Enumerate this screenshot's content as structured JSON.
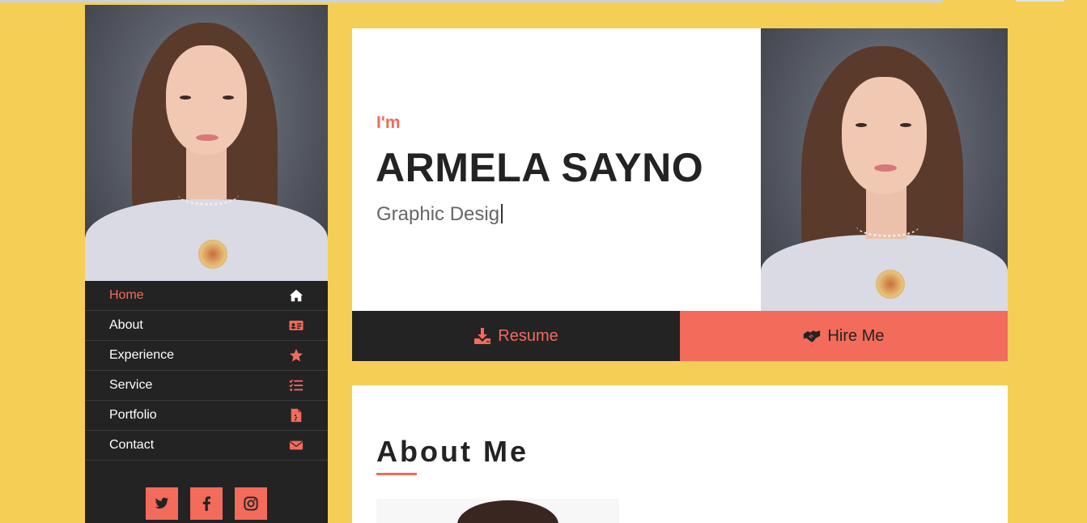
{
  "sidebar": {
    "nav": [
      {
        "label": "Home",
        "icon": "home-icon",
        "active": true
      },
      {
        "label": "About",
        "icon": "id-card-icon",
        "active": false
      },
      {
        "label": "Experience",
        "icon": "star-icon",
        "active": false
      },
      {
        "label": "Service",
        "icon": "task-list-icon",
        "active": false
      },
      {
        "label": "Portfolio",
        "icon": "file-icon",
        "active": false
      },
      {
        "label": "Contact",
        "icon": "envelope-icon",
        "active": false
      }
    ],
    "socials": [
      "twitter-icon",
      "facebook-icon",
      "instagram-icon"
    ]
  },
  "hero": {
    "intro": "I'm",
    "name": "ARMELA SAYNO",
    "role": "Graphic Desig",
    "resume_label": "Resume",
    "hire_label": "Hire Me"
  },
  "about": {
    "title": "About Me"
  },
  "colors": {
    "background": "#f5cf55",
    "accent": "#f26b5b",
    "dark": "#232323"
  }
}
